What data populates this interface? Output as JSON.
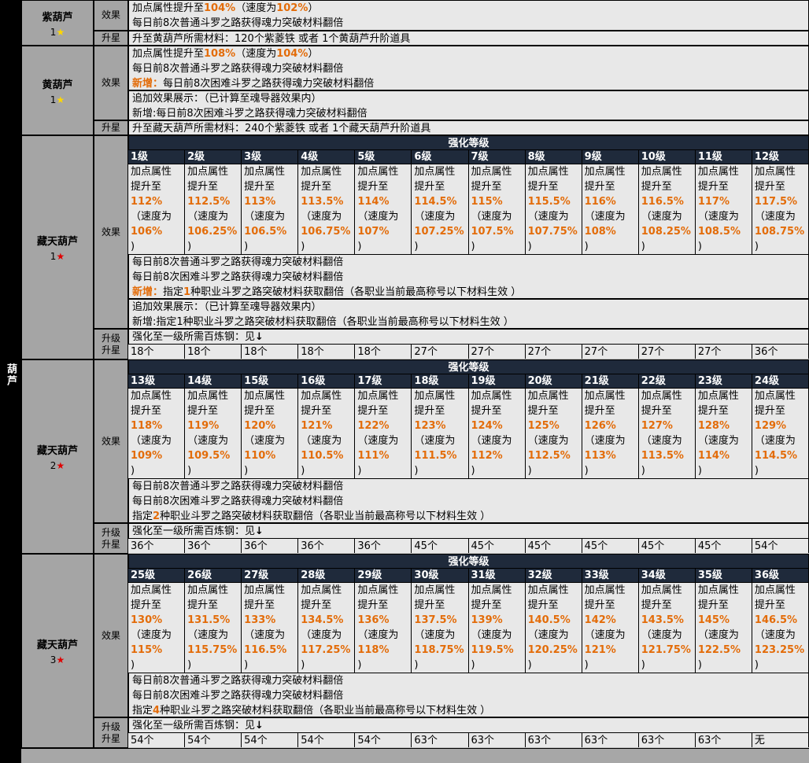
{
  "sidebar": {
    "label": "葫芦"
  },
  "colors": {
    "accent_orange": "#e36c09",
    "header_navy": "#1f2a3b",
    "star_yellow": "#ffd700",
    "star_red": "#e00000"
  },
  "labels": {
    "effect": "效果",
    "upgrade": "升星",
    "upgrade_level": "升级\n升星",
    "attr_line1": "加点属性",
    "attr_line2": "提升至",
    "speed_open": "（速度为",
    "close_paren": ")",
    "enhance_header": "强化等级",
    "steel_text": "强化至一级所需百炼钢：见",
    "arrow": "↓"
  },
  "purple": {
    "name": "紫葫芦",
    "level": "1",
    "star": "★",
    "effect": {
      "pre": "加点属性提升至",
      "v1": "104%",
      "mid": "（速度为",
      "v2": "102%",
      "post": "）",
      "line2": "每日前8次普通斗罗之路获得魂力突破材料翻倍"
    },
    "upgrade": "升至黄葫芦所需材料：120个紫菱铁 或者 1个黄葫芦升阶道具"
  },
  "yellow": {
    "name": "黄葫芦",
    "level": "1",
    "star": "★",
    "effect": {
      "pre": "加点属性提升至",
      "v1": "108%",
      "mid": "（速度为",
      "v2": "104%",
      "post": "）",
      "line2": "每日前8次普通斗罗之路获得魂力突破材料翻倍",
      "new_tag": "新增：",
      "line3": "每日前8次困难斗罗之路获得魂力突破材料翻倍"
    },
    "extra1": "追加效果展示：（已计算至魂导器效果内）",
    "extra2": "新增:每日前8次困难斗罗之路获得魂力突破材料翻倍",
    "upgrade": "升至藏天葫芦所需材料：240个紫菱铁 或者 1个藏天葫芦升阶道具"
  },
  "tian1": {
    "name": "藏天葫芦",
    "level": "1",
    "star": "★",
    "levels": [
      {
        "lv": "1级",
        "a": "112%",
        "s": "106%"
      },
      {
        "lv": "2级",
        "a": "112.5%",
        "s": "106.25%"
      },
      {
        "lv": "3级",
        "a": "113%",
        "s": "106.5%"
      },
      {
        "lv": "4级",
        "a": "113.5%",
        "s": "106.75%"
      },
      {
        "lv": "5级",
        "a": "114%",
        "s": "107%"
      },
      {
        "lv": "6级",
        "a": "114.5%",
        "s": "107.25%"
      },
      {
        "lv": "7级",
        "a": "115%",
        "s": "107.5%"
      },
      {
        "lv": "8级",
        "a": "115.5%",
        "s": "107.75%"
      },
      {
        "lv": "9级",
        "a": "116%",
        "s": "108%"
      },
      {
        "lv": "10级",
        "a": "116.5%",
        "s": "108.25%"
      },
      {
        "lv": "11级",
        "a": "117%",
        "s": "108.5%"
      },
      {
        "lv": "12级",
        "a": "117.5%",
        "s": "108.75%"
      }
    ],
    "line1": "每日前8次普通斗罗之路获得魂力突破材料翻倍",
    "line2": "每日前8次困难斗罗之路获得魂力突破材料翻倍",
    "line3_new": "新增：",
    "line3_pre": "指定",
    "line3_num": "1",
    "line3_post": "种职业斗罗之路突破材料获取翻倍（各职业当前最高称号以下材料生效 ）",
    "extra1": "追加效果展示：（已计算至魂导器效果内）",
    "extra2": "新增:指定1种职业斗罗之路突破材料获取翻倍（各职业当前最高称号以下材料生效 ）",
    "materials": [
      "18个",
      "18个",
      "18个",
      "18个",
      "18个",
      "27个",
      "27个",
      "27个",
      "27个",
      "27个",
      "27个",
      "36个"
    ]
  },
  "tian2": {
    "name": "藏天葫芦",
    "level": "2",
    "star": "★",
    "levels": [
      {
        "lv": "13级",
        "a": "118%",
        "s": "109%"
      },
      {
        "lv": "14级",
        "a": "119%",
        "s": "109.5%"
      },
      {
        "lv": "15级",
        "a": "120%",
        "s": "110%"
      },
      {
        "lv": "16级",
        "a": "121%",
        "s": "110.5%"
      },
      {
        "lv": "17级",
        "a": "122%",
        "s": "111%"
      },
      {
        "lv": "18级",
        "a": "123%",
        "s": "111.5%"
      },
      {
        "lv": "19级",
        "a": "124%",
        "s": "112%"
      },
      {
        "lv": "20级",
        "a": "125%",
        "s": "112.5%"
      },
      {
        "lv": "21级",
        "a": "126%",
        "s": "113%"
      },
      {
        "lv": "22级",
        "a": "127%",
        "s": "113.5%"
      },
      {
        "lv": "23级",
        "a": "128%",
        "s": "114%"
      },
      {
        "lv": "24级",
        "a": "129%",
        "s": "114.5%"
      }
    ],
    "line1": "每日前8次普通斗罗之路获得魂力突破材料翻倍",
    "line2": "每日前8次困难斗罗之路获得魂力突破材料翻倍",
    "line3_pre": "指定",
    "line3_num": "2",
    "line3_post": "种职业斗罗之路突破材料获取翻倍（各职业当前最高称号以下材料生效 ）",
    "materials": [
      "36个",
      "36个",
      "36个",
      "36个",
      "36个",
      "45个",
      "45个",
      "45个",
      "45个",
      "45个",
      "45个",
      "54个"
    ]
  },
  "tian3": {
    "name": "藏天葫芦",
    "level": "3",
    "star": "★",
    "levels": [
      {
        "lv": "25级",
        "a": "130%",
        "s": "115%"
      },
      {
        "lv": "26级",
        "a": "131.5%",
        "s": "115.75%"
      },
      {
        "lv": "27级",
        "a": "133%",
        "s": "116.5%"
      },
      {
        "lv": "28级",
        "a": "134.5%",
        "s": "117.25%"
      },
      {
        "lv": "29级",
        "a": "136%",
        "s": "118%"
      },
      {
        "lv": "30级",
        "a": "137.5%",
        "s": "118.75%"
      },
      {
        "lv": "31级",
        "a": "139%",
        "s": "119.5%"
      },
      {
        "lv": "32级",
        "a": "140.5%",
        "s": "120.25%"
      },
      {
        "lv": "33级",
        "a": "142%",
        "s": "121%"
      },
      {
        "lv": "34级",
        "a": "143.5%",
        "s": "121.75%"
      },
      {
        "lv": "35级",
        "a": "145%",
        "s": "122.5%"
      },
      {
        "lv": "36级",
        "a": "146.5%",
        "s": "123.25%"
      }
    ],
    "line1": "每日前8次普通斗罗之路获得魂力突破材料翻倍",
    "line2": "每日前8次困难斗罗之路获得魂力突破材料翻倍",
    "line3_pre": "指定",
    "line3_num": "4",
    "line3_post": "种职业斗罗之路突破材料获取翻倍（各职业当前最高称号以下材料生效 ）",
    "materials": [
      "54个",
      "54个",
      "54个",
      "54个",
      "54个",
      "63个",
      "63个",
      "63个",
      "63个",
      "63个",
      "63个",
      "无"
    ]
  }
}
